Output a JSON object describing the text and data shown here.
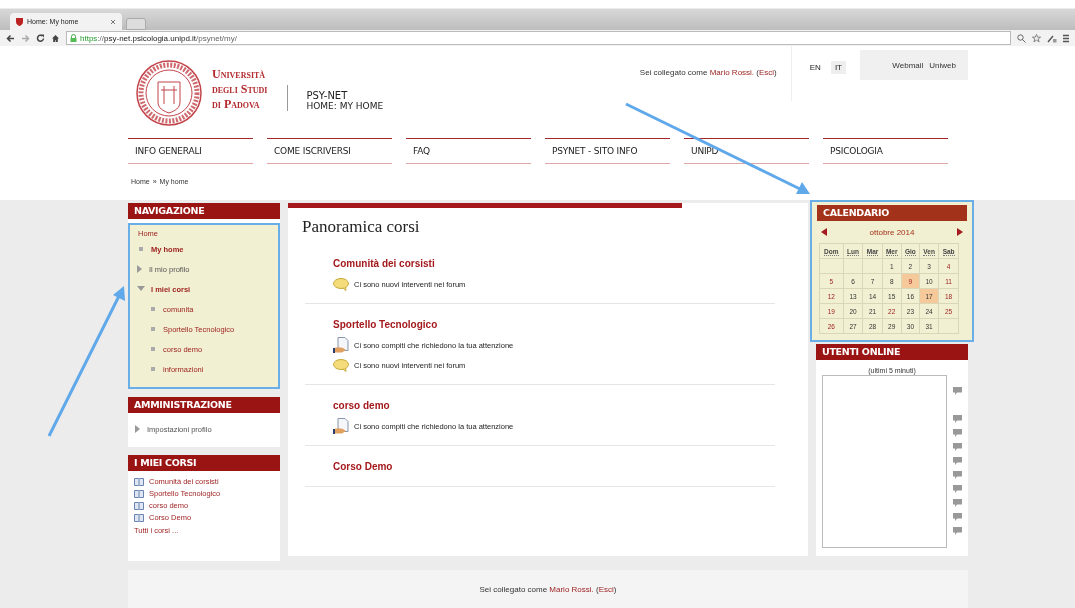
{
  "browser": {
    "tab_title": "Home: My home",
    "url": {
      "scheme": "https",
      "separator": "://",
      "host": "psy-net.psicologia.unipd.it",
      "path": "/psynet/my/"
    }
  },
  "header": {
    "university": [
      "Università",
      "degli Studi",
      "di Padova"
    ],
    "site_name": "PSY-NET",
    "page_title": "HOME: MY HOME",
    "login": {
      "prefix": "Sei collegato come ",
      "user": "Mario Rossi.",
      "open": " (",
      "logout": "Esci",
      "close": ")"
    },
    "languages": [
      {
        "label": "EN",
        "selected": false
      },
      {
        "label": "IT",
        "selected": true
      }
    ],
    "links": [
      "Webmail",
      "Uniweb"
    ]
  },
  "menu": [
    "INFO GENERALI",
    "COME ISCRIVERSI",
    "FAQ",
    "PSYNET - SITO INFO",
    "UNIPD",
    "PSICOLOGIA"
  ],
  "breadcrumb": {
    "items": [
      "Home",
      "My home"
    ],
    "separator": "»"
  },
  "navigation": {
    "title": "NAVIGAZIONE",
    "highlighted": true,
    "root": "Home",
    "items": [
      {
        "label": "My home",
        "kind": "leaf",
        "selected": true
      },
      {
        "label": "Il mio profilo",
        "kind": "branch",
        "expanded": false
      },
      {
        "label": "I miei corsi",
        "kind": "branch",
        "expanded": true,
        "children": [
          {
            "label": "comunita",
            "kind": "leaf",
            "selected": false
          },
          {
            "label": "Sportello Tecnologico",
            "kind": "leaf",
            "selected": false
          },
          {
            "label": "corso demo",
            "kind": "leaf",
            "selected": false
          },
          {
            "label": "informazioni",
            "kind": "leaf",
            "selected": false
          }
        ]
      }
    ]
  },
  "administration": {
    "title": "AMMINISTRAZIONE",
    "items": [
      {
        "label": "Impostazioni profilo",
        "kind": "branch",
        "expanded": false
      }
    ]
  },
  "my_courses": {
    "title": "I MIEI CORSI",
    "courses": [
      "Comunità dei corsisti",
      "Sportello Tecnologico",
      "corso demo",
      "Corso Demo"
    ],
    "all_link": "Tutti i corsi ..."
  },
  "overview": {
    "title": "Panoramica corsi",
    "courses": [
      {
        "name": "Comunità dei corsisti",
        "notices": [
          {
            "kind": "forum",
            "text": "Ci sono nuovi interventi nei forum"
          }
        ]
      },
      {
        "name": "Sportello Tecnologico",
        "notices": [
          {
            "kind": "assignment",
            "text": "Ci sono compiti che richiedono la tua attenzione"
          },
          {
            "kind": "forum",
            "text": "Ci sono nuovi interventi nei forum"
          }
        ]
      },
      {
        "name": "corso demo",
        "notices": [
          {
            "kind": "assignment",
            "text": "Ci sono compiti che richiedono la tua attenzione"
          }
        ]
      },
      {
        "name": "Corso Demo"
      }
    ]
  },
  "calendar": {
    "title": "CALENDARIO",
    "highlighted": true,
    "month": "ottobre 2014",
    "weekdays": [
      "Dom",
      "Lun",
      "Mar",
      "Mer",
      "Gio",
      "Ven",
      "Sab"
    ],
    "weeks": [
      [
        {
          "kind": "empty"
        },
        {
          "kind": "empty"
        },
        {
          "kind": "empty"
        },
        {
          "day": "1",
          "kind": "day",
          "event": false
        },
        {
          "day": "2",
          "kind": "day",
          "event": false
        },
        {
          "day": "3",
          "kind": "day",
          "event": false
        },
        {
          "day": "4",
          "kind": "holiday",
          "event": false
        }
      ],
      [
        {
          "day": "5",
          "kind": "holiday",
          "event": false
        },
        {
          "day": "6",
          "kind": "day",
          "event": false
        },
        {
          "day": "7",
          "kind": "day",
          "event": false
        },
        {
          "day": "8",
          "kind": "day",
          "event": false
        },
        {
          "day": "9",
          "kind": "holiday",
          "event": true
        },
        {
          "day": "10",
          "kind": "day",
          "event": false
        },
        {
          "day": "11",
          "kind": "holiday",
          "event": false
        }
      ],
      [
        {
          "day": "12",
          "kind": "holiday",
          "event": false
        },
        {
          "day": "13",
          "kind": "day",
          "event": false
        },
        {
          "day": "14",
          "kind": "day",
          "event": false
        },
        {
          "day": "15",
          "kind": "day",
          "event": false
        },
        {
          "day": "16",
          "kind": "day",
          "event": false
        },
        {
          "day": "17",
          "kind": "day",
          "event": true
        },
        {
          "day": "18",
          "kind": "holiday",
          "event": false
        }
      ],
      [
        {
          "day": "19",
          "kind": "holiday",
          "event": false
        },
        {
          "day": "20",
          "kind": "day",
          "event": false
        },
        {
          "day": "21",
          "kind": "day",
          "event": false
        },
        {
          "day": "22",
          "kind": "holiday",
          "event": false
        },
        {
          "day": "23",
          "kind": "day",
          "event": false
        },
        {
          "day": "24",
          "kind": "day",
          "event": false
        },
        {
          "day": "25",
          "kind": "holiday",
          "event": false
        }
      ],
      [
        {
          "day": "26",
          "kind": "holiday",
          "event": false
        },
        {
          "day": "27",
          "kind": "day",
          "event": false
        },
        {
          "day": "28",
          "kind": "day",
          "event": false
        },
        {
          "day": "29",
          "kind": "day",
          "event": false
        },
        {
          "day": "30",
          "kind": "day",
          "event": false
        },
        {
          "day": "31",
          "kind": "day",
          "event": false
        },
        {
          "kind": "empty"
        }
      ]
    ]
  },
  "online_users": {
    "title": "UTENTI ONLINE",
    "period": "(ultimi 5 minuti)"
  },
  "footer": {
    "login": {
      "prefix": "Sei collegato come ",
      "user": "Mario Rossi.",
      "open": " (",
      "logout": "Esci",
      "close": ")"
    }
  }
}
